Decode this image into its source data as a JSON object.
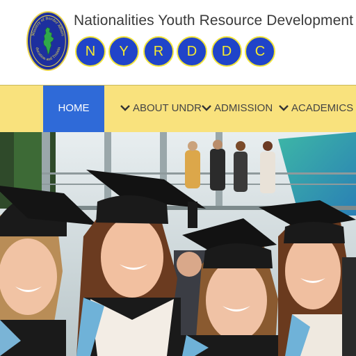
{
  "header": {
    "title": "Nationalities Youth Resource Development Degree College",
    "logo_text_top": "Ministry of Border Affairs",
    "logo_text_bottom": "Education and Training",
    "acronym": [
      "N",
      "Y",
      "R",
      "D",
      "D",
      "C"
    ]
  },
  "nav": {
    "items": [
      {
        "label": "HOME",
        "active": true
      },
      {
        "label": "ABOUT UNDR",
        "active": false
      },
      {
        "label": "ADMISSION",
        "active": false
      },
      {
        "label": "ACADEMICS",
        "active": false
      }
    ]
  },
  "colors": {
    "nav_bg": "#f9e27d",
    "nav_active": "#2f6ad8",
    "logo_blue": "#1d2f9e",
    "letter_blue": "#2044c9",
    "letter_yellow": "#f5ea2e"
  },
  "hero": {
    "image": "graduates-photo"
  }
}
